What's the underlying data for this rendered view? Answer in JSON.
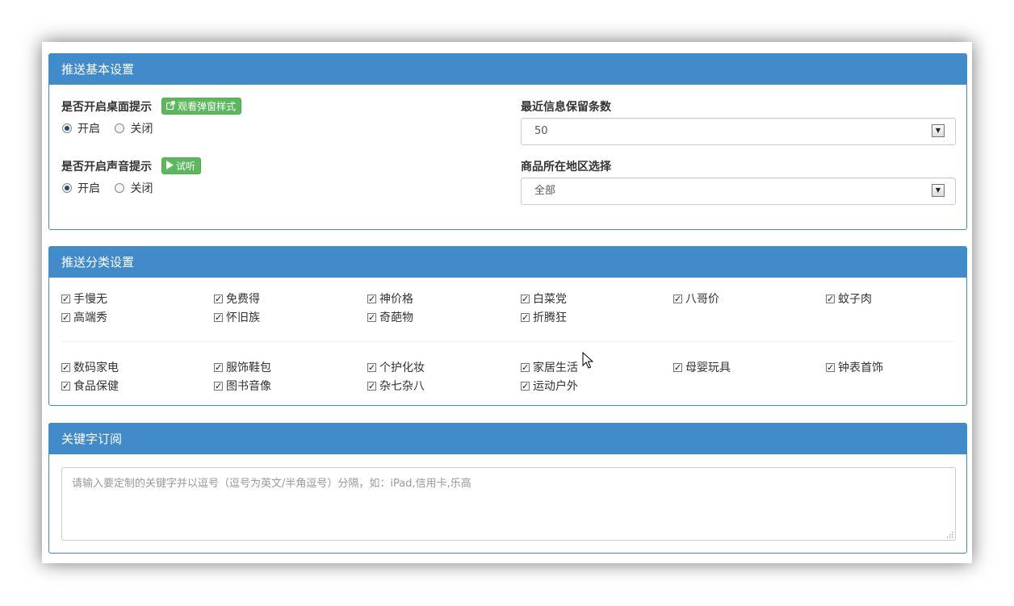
{
  "basic": {
    "title": "推送基本设置",
    "desktop_label": "是否开启桌面提示",
    "desktop_btn": "观看弹窗样式",
    "desktop_on": "开启",
    "desktop_off": "关闭",
    "sound_label": "是否开启声音提示",
    "sound_btn": "试听",
    "sound_on": "开启",
    "sound_off": "关闭",
    "retain_label": "最近信息保留条数",
    "retain_value": "50",
    "region_label": "商品所在地区选择",
    "region_value": "全部"
  },
  "category": {
    "title": "推送分类设置",
    "group1": [
      "手慢无",
      "免费得",
      "神价格",
      "白菜党",
      "八哥价",
      "蚊子肉",
      "高端秀",
      "怀旧族",
      "奇葩物",
      "折腾狂"
    ],
    "group2": [
      "数码家电",
      "服饰鞋包",
      "个护化妆",
      "家居生活",
      "母婴玩具",
      "钟表首饰",
      "食品保健",
      "图书音像",
      "杂七杂八",
      "运动户外"
    ]
  },
  "keyword": {
    "title": "关键字订阅",
    "placeholder": "请输入要定制的关键字并以逗号（逗号为英文/半角逗号）分隔，如：iPad,信用卡,乐高"
  },
  "colors": {
    "panel_header": "#428bca",
    "button_green": "#5cb85c"
  }
}
